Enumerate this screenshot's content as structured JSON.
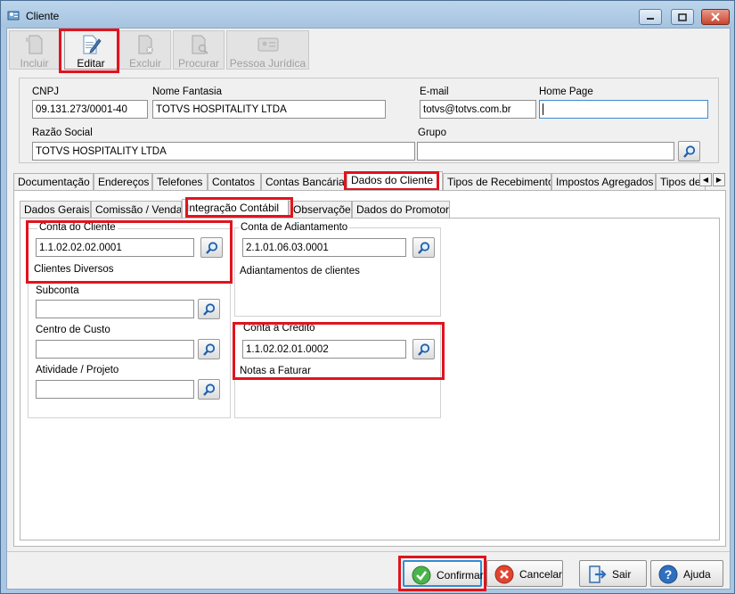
{
  "window": {
    "title": "Cliente"
  },
  "toolbar": {
    "incluir": "Incluir",
    "editar": "Editar",
    "excluir": "Excluir",
    "procurar": "Procurar",
    "pessoa_juridica": "Pessoa Jurídica"
  },
  "header": {
    "cnpj_label": "CNPJ",
    "cnpj_value": "09.131.273/0001-40",
    "nome_fantasia_label": "Nome Fantasia",
    "nome_fantasia_value": "TOTVS HOSPITALITY LTDA",
    "email_label": "E-mail",
    "email_value": "totvs@totvs.com.br",
    "homepage_label": "Home Page",
    "homepage_value": "",
    "razao_social_label": "Razão Social",
    "razao_social_value": "TOTVS HOSPITALITY LTDA",
    "grupo_label": "Grupo",
    "grupo_value": ""
  },
  "main_tabs": [
    "Documentação",
    "Endereços",
    "Telefones",
    "Contatos",
    "Contas Bancárias",
    "Dados do Cliente",
    "Tipos de Recebimento",
    "Impostos Agregados",
    "Tipos de"
  ],
  "sub_tabs": [
    "Dados Gerais",
    "Comissão / Vendas",
    "Integração Contábil",
    "Observações",
    "Dados do Promotor"
  ],
  "integracao": {
    "conta_cliente_label": "Conta do Cliente",
    "conta_cliente_value": "1.1.02.02.02.0001",
    "conta_cliente_desc": "Clientes Diversos",
    "subconta_label": "Subconta",
    "subconta_value": "",
    "centro_custo_label": "Centro de Custo",
    "centro_custo_value": "",
    "atividade_label": "Atividade / Projeto",
    "atividade_value": "",
    "conta_adiantamento_label": "Conta de Adiantamento",
    "conta_adiantamento_value": "2.1.01.06.03.0001",
    "conta_adiantamento_desc": "Adiantamentos de clientes",
    "conta_credito_label": "Conta a Crédito",
    "conta_credito_value": "1.1.02.02.01.0002",
    "conta_credito_desc": "Notas a Faturar"
  },
  "buttons": {
    "confirmar": "Confirmar",
    "cancelar": "Cancelar",
    "sair": "Sair",
    "ajuda": "Ajuda"
  },
  "colors": {
    "highlight": "#e0141e",
    "focus_border": "#2d8fd4"
  }
}
